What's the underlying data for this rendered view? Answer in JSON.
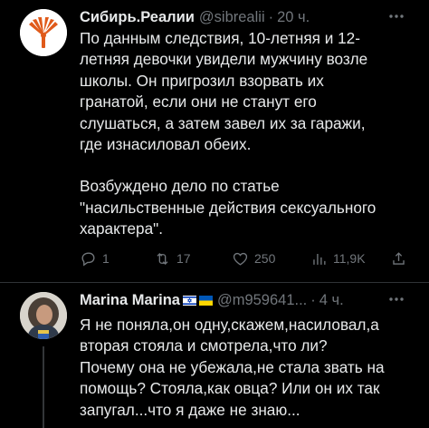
{
  "tweet1": {
    "author_name": "Сибирь.Реалии",
    "handle": "@sibrealii",
    "separator": "·",
    "time": "20 ч.",
    "paragraph1": [
      "По данным следствия, 10-летняя и 12-",
      "летняя девочки увидели мужчину возле",
      "школы. Он пригрозил взорвать их",
      "гранатой, если они не станут его",
      "слушаться, а затем завел их за гаражи,",
      "где изнасиловал обеих."
    ],
    "paragraph2": [
      "Возбуждено дело по статье",
      "\"насильственные действия сексуального",
      "характера\"."
    ],
    "actions": {
      "replies": "1",
      "retweets": "17",
      "likes": "250",
      "views": "11,9K"
    },
    "colors": {
      "brand": "#e05a1a"
    }
  },
  "tweet2": {
    "author_name": "Marina Marina",
    "handle": "@m959641...",
    "separator": "·",
    "time": "4 ч.",
    "lines": [
      "Я не поняла,он одну,скажем,насиловал,а",
      "вторая стояла и смотрела,что ли?",
      "Почему она не убежала,не стала звать на",
      "помощь? Стояла,как овца? Или он их так",
      "запугал...что я даже не знаю..."
    ]
  },
  "icons": {
    "more": "more-icon",
    "reply": "reply-icon",
    "retweet": "retweet-icon",
    "like": "heart-icon",
    "views": "views-icon",
    "share": "share-icon",
    "flag_israel": "israel-flag-icon",
    "flag_ukraine": "ukraine-flag-icon"
  }
}
